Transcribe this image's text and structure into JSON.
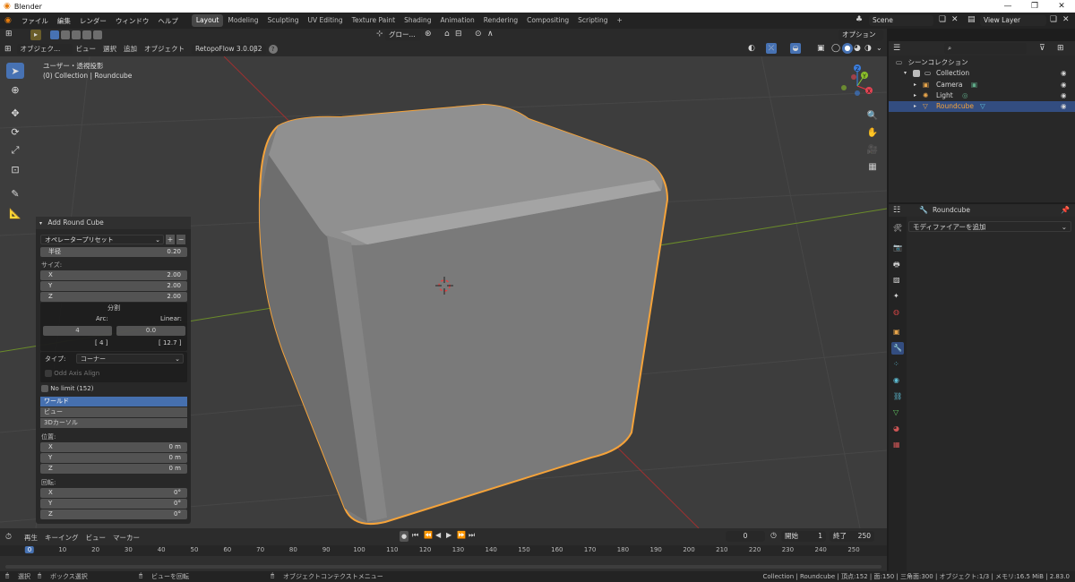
{
  "window": {
    "title": "Blender",
    "minimize": "—",
    "maximize": "❐",
    "close": "✕"
  },
  "menu": [
    "ファイル",
    "編集",
    "レンダー",
    "ウィンドウ",
    "ヘルプ"
  ],
  "workspaces": [
    "Layout",
    "Modeling",
    "Sculpting",
    "UV Editing",
    "Texture Paint",
    "Shading",
    "Animation",
    "Rendering",
    "Compositing",
    "Scripting"
  ],
  "workspace_add": "+",
  "scene": {
    "name": "Scene",
    "view_layer": "View Layer"
  },
  "toolbar": {
    "transform_orient": "グロー...",
    "options_label": "オプション"
  },
  "viewport_header": {
    "mode": "オブジェク...",
    "items": [
      "ビュー",
      "選択",
      "追加",
      "オブジェクト"
    ],
    "addon": "RetopoFlow 3.0.0β2",
    "help": "?"
  },
  "viewport": {
    "view_name": "ユーザー・透視投影",
    "context": "(0) Collection | Roundcube",
    "gizmo": {
      "x": "X",
      "y": "Y",
      "z": "Z"
    }
  },
  "operator_panel": {
    "title": "Add Round Cube",
    "preset_label": "オペレータープリセット",
    "preset_add": "+",
    "preset_remove": "−",
    "radius_label": "半径",
    "radius_value": "0.20",
    "size_label": "サイズ:",
    "size": [
      {
        "axis": "X",
        "value": "2.00"
      },
      {
        "axis": "Y",
        "value": "2.00"
      },
      {
        "axis": "Z",
        "value": "2.00"
      }
    ],
    "division_label": "分割",
    "arc_label": "Arc:",
    "linear_label": "Linear:",
    "arc_value": "4",
    "linear_value": "0.0",
    "arc_result": "[ 4 ]",
    "linear_result": "[ 12.7 ]",
    "type_label": "タイプ:",
    "type_value": "コーナー",
    "odd_axis_label": "Odd Axis Align",
    "no_limit_label": "No limit (152)",
    "align_options": [
      "ワールド",
      "ビュー",
      "3Dカーソル"
    ],
    "location_label": "位置:",
    "location": [
      {
        "axis": "X",
        "value": "0 m"
      },
      {
        "axis": "Y",
        "value": "0 m"
      },
      {
        "axis": "Z",
        "value": "0 m"
      }
    ],
    "rotation_label": "回転:",
    "rotation": [
      {
        "axis": "X",
        "value": "0°"
      },
      {
        "axis": "Y",
        "value": "0°"
      },
      {
        "axis": "Z",
        "value": "0°"
      }
    ]
  },
  "timeline": {
    "menus": [
      "再生",
      "キーイング",
      "ビュー",
      "マーカー"
    ],
    "current_frame": "0",
    "start_label": "開始",
    "start": "1",
    "end_label": "終了",
    "end": "250",
    "ticks": [
      "0",
      "10",
      "20",
      "30",
      "40",
      "50",
      "60",
      "70",
      "80",
      "90",
      "100",
      "110",
      "120",
      "130",
      "140",
      "150",
      "160",
      "170",
      "180",
      "190",
      "200",
      "210",
      "220",
      "230",
      "240",
      "250"
    ]
  },
  "outliner": {
    "scene_collection": "シーンコレクション",
    "items": [
      {
        "name": "Collection",
        "selected": false
      },
      {
        "name": "Camera",
        "selected": false
      },
      {
        "name": "Light",
        "selected": false
      },
      {
        "name": "Roundcube",
        "selected": true
      }
    ]
  },
  "properties": {
    "object_name": "Roundcube",
    "add_modifier": "モディファイアーを追加"
  },
  "statusbar": {
    "select": "選択",
    "box_select": "ボックス選択",
    "rotate_view": "ビューを回転",
    "context_menu": "オブジェクトコンテクストメニュー",
    "stats": "Collection | Roundcube | 頂点:152 | 面:150 | 三角面:300 | オブジェクト:1/3 | メモリ:16.5 MiB | 2.83.0"
  },
  "colors": {
    "accent": "#4772b3",
    "outline": "#f5a33a",
    "grid_x": "#a03030",
    "grid_y": "#6b8c2a"
  }
}
